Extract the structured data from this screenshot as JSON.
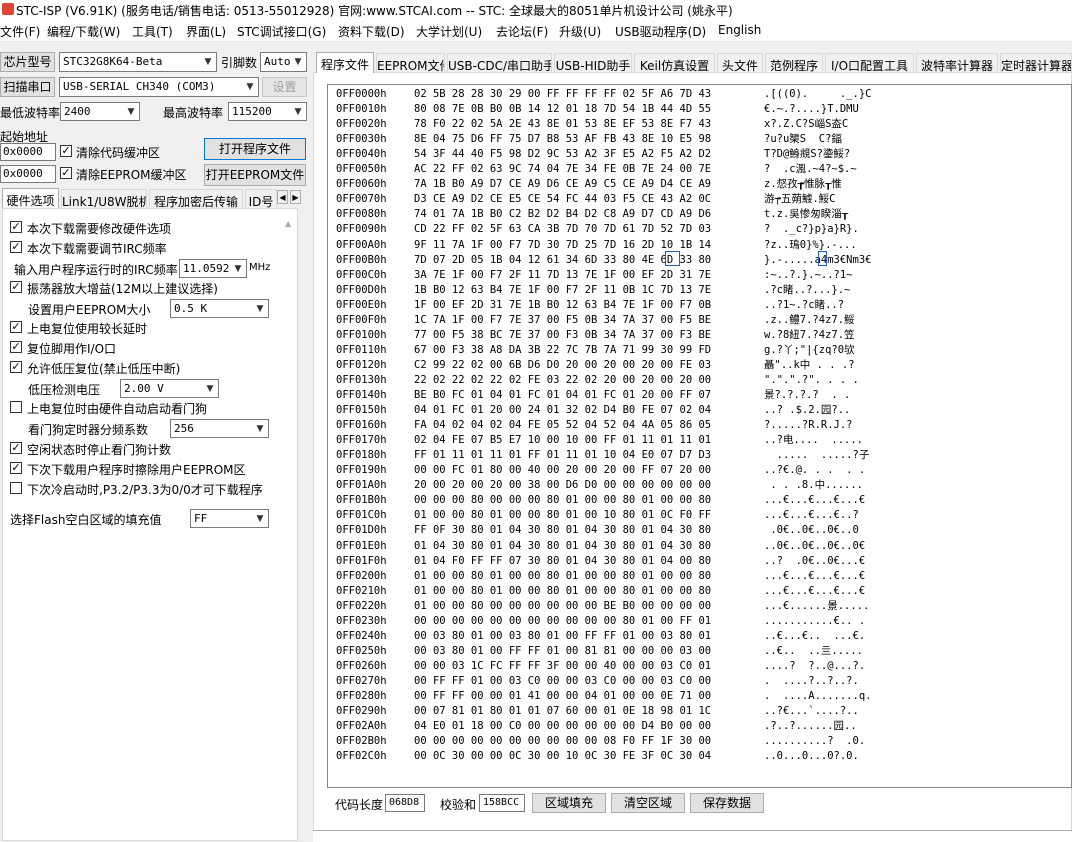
{
  "window": {
    "title": "STC-ISP (V6.91K) (服务电话/销售电话: 0513-55012928) 官网:www.STCAI.com  -- STC: 全球最大的8051单片机设计公司 (姚永平)"
  },
  "menu": [
    "文件(F)",
    "编程/下载(W)",
    "工具(T)",
    "界面(L)",
    "STC调试接口(G)",
    "资料下载(D)",
    "大学计划(U)",
    "去论坛(F)",
    "升级(U)",
    "USB驱动程序(D)",
    "English"
  ],
  "left": {
    "chip_label": "芯片型号",
    "chip_value": "STC32G8K64-Beta",
    "pins_label": "引脚数",
    "pins_value": "Auto",
    "scan_label": "扫描串口",
    "port_value": "USB-SERIAL CH340 (COM3)",
    "settings_label": "设置",
    "min_baud_label": "最低波特率",
    "min_baud_value": "2400",
    "max_baud_label": "最高波特率",
    "max_baud_value": "115200",
    "start_addr_label": "起始地址",
    "addr1": "0x0000",
    "clear_code_label": "清除代码缓冲区",
    "addr2": "0x0000",
    "clear_eeprom_label": "清除EEPROM缓冲区",
    "open_prog_label": "打开程序文件",
    "open_eeprom_label": "打开EEPROM文件",
    "tabs": [
      "硬件选项",
      "Link1/U8W脱机",
      "程序加密后传输",
      "ID号"
    ],
    "options": [
      {
        "label": "本次下载需要修改硬件选项",
        "checked": "✓"
      },
      {
        "label": "本次下载需要调节IRC频率",
        "checked": "✓"
      },
      {
        "label": "振荡器放大增益(12M以上建议选择)",
        "checked": "✓"
      },
      {
        "label": "上电复位使用较长延时",
        "checked": "✓"
      },
      {
        "label": "复位脚用作I/O口",
        "checked": "✓"
      },
      {
        "label": "允许低压复位(禁止低压中断)",
        "checked": "✓"
      },
      {
        "label": "上电复位时由硬件自动启动看门狗",
        "checked": ""
      },
      {
        "label": "空闲状态时停止看门狗计数",
        "checked": "✓"
      },
      {
        "label": "下次下载用户程序时擦除用户EEPROM区",
        "checked": "✓"
      },
      {
        "label": "下次冷启动时,P3.2/P3.3为0/0才可下载程序",
        "checked": ""
      }
    ],
    "irc_label": "输入用户程序运行时的IRC频率",
    "irc_value": "11.0592",
    "irc_unit": "MHz",
    "eeprom_size_label": "设置用户EEPROM大小",
    "eeprom_size_value": "0.5 K",
    "lvd_label": "低压检测电压",
    "lvd_value": "2.00 V",
    "wdt_label": "看门狗定时器分频系数",
    "wdt_value": "256",
    "fill_label": "选择Flash空白区域的填充值",
    "fill_value": "FF"
  },
  "right": {
    "tabs": [
      "程序文件",
      "EEPROM文件",
      "USB-CDC/串口助手",
      "USB-HID助手",
      "Keil仿真设置",
      "头文件",
      "范例程序",
      "I/O口配置工具",
      "波特率计算器",
      "定时器计算器"
    ],
    "rows": [
      {
        "addr": "0FF0000h",
        "hex": "02 5B 28 28 30 29 00 FF FF FF FF 02 5F A6 7D 43",
        "ascii": ".[((0).     ._.}C"
      },
      {
        "addr": "0FF0010h",
        "hex": "80 08 7E 0B B0 0B 14 12 01 18 7D 54 1B 44 4D 55",
        "ascii": "€.~.?....}T.DMU"
      },
      {
        "addr": "0FF0020h",
        "hex": "78 F0 22 02 5A 2E 43 8E 01 53 8E EF 53 8E F7 43",
        "ascii": "x?.Z.C?S崰S盇C"
      },
      {
        "addr": "0FF0030h",
        "hex": "8E 04 75 D6 FF 75 D7 B8 53 AF FB 43 8E 10 E5 98",
        "ascii": "?u?u榘S  C?鍢"
      },
      {
        "addr": "0FF0040h",
        "hex": "54 3F 44 40 F5 98 D2 9C 53 A2 3F E5 A2 F5 A2 D2",
        "ascii": "T?D@鯓覜S?鍌鮾?"
      },
      {
        "addr": "0FF0050h",
        "hex": "AC 22 FF 02 63 9C 74 04 7E 34 FE 0B 7E 24 00 7E",
        "ascii": "?  .c渢.~4?~$.~"
      },
      {
        "addr": "0FF0060h",
        "hex": "7A 1B B0 A9 D7 CE A9 D6 CE A9 C5 CE A9 D4 CE A9",
        "ascii": "z.惄孜┲惟脉┰惟"
      },
      {
        "addr": "0FF0070h",
        "hex": "D3 CE A9 D2 CE E5 CE 54 FC 44 03 F5 CE 43 A2 0C",
        "ascii": "游┮五蒴鰬.鮾C"
      },
      {
        "addr": "0FF0080h",
        "hex": "74 01 7A 1B B0 C2 B2 D2 B4 D2 C8 A9 D7 CD A9 D6",
        "ascii": "t.z.吳惨匆睽淄┰"
      },
      {
        "addr": "0FF0090h",
        "hex": "CD 22 FF 02 5F 63 CA 3B 7D 70 7D 61 7D 52 7D 03",
        "ascii": "?  ._c?}p}a}R}."
      },
      {
        "addr": "0FF00A0h",
        "hex": "9F 11 7A 1F 00 F7 7D 30 7D 25 7D 16 2D 10 1B 14",
        "ascii": "?z..鳿0}%}.-..."
      },
      {
        "addr": "0FF00B0h",
        "hex": "7D 07 2D 05 1B 04 12 61 34 6D 33 80 4E 6D 33 80",
        "ascii": "}.-.....a4m3€Nm3€"
      },
      {
        "addr": "0FF00C0h",
        "hex": "3A 7E 1F 00 F7 2F 11 7D 13 7E 1F 00 EF 2D 31 7E",
        "ascii": ":~..?.}.~..?1~"
      },
      {
        "addr": "0FF00D0h",
        "hex": "1B B0 12 63 B4 7E 1F 00 F7 2F 11 0B 1C 7D 13 7E",
        "ascii": ".?c睹..?...}.~"
      },
      {
        "addr": "0FF00E0h",
        "hex": "1F 00 EF 2D 31 7E 1B B0 12 63 B4 7E 1F 00 F7 0B",
        "ascii": "..?1~.?c睹..?"
      },
      {
        "addr": "0FF00F0h",
        "hex": "1C 7A 1F 00 F7 7E 37 00 F5 0B 34 7A 37 00 F5 BE",
        "ascii": ".z..鳢7.?4z7.鮾"
      },
      {
        "addr": "0FF0100h",
        "hex": "77 00 F5 38 BC 7E 37 00 F3 0B 34 7A 37 00 F3 BE",
        "ascii": "w.?8紐7.?4z7.笠"
      },
      {
        "addr": "0FF0110h",
        "hex": "67 00 F3 38 A8 DA 3B 22 7C 7B 7A 71 99 30 99 FD",
        "ascii": "g.?丫;\"|{zq?0欤"
      },
      {
        "addr": "0FF0120h",
        "hex": "C2 99 22 02 00 6B D6 D0 20 00 20 00 20 00 FE 03",
        "ascii": "聶\"..k中 . . .?"
      },
      {
        "addr": "0FF0130h",
        "hex": "22 02 22 02 22 02 FE 03 22 02 20 00 20 00 20 00",
        "ascii": "\".\".\".?\". . . ."
      },
      {
        "addr": "0FF0140h",
        "hex": "BE B0 FC 01 04 01 FC 01 04 01 FC 01 20 00 FF 07",
        "ascii": "景?.?.?.?  . ."
      },
      {
        "addr": "0FF0150h",
        "hex": "04 01 FC 01 20 00 24 01 32 02 D4 B0 FE 07 02 04",
        "ascii": "..? .$.2.园?.."
      },
      {
        "addr": "0FF0160h",
        "hex": "FA 04 02 04 02 04 FE 05 52 04 52 04 4A 05 86 05",
        "ascii": "?.....?R.R.J.?"
      },
      {
        "addr": "0FF0170h",
        "hex": "02 04 FE 07 B5 E7 10 00 10 00 FF 01 11 01 11 01",
        "ascii": "..?电....  ....."
      },
      {
        "addr": "0FF0180h",
        "hex": "FF 01 11 01 11 01 FF 01 11 01 10 04 E0 07 D7 D3",
        "ascii": "  .....  .....?子"
      },
      {
        "addr": "0FF0190h",
        "hex": "00 00 FC 01 80 00 40 00 20 00 20 00 FF 07 20 00",
        "ascii": "..?€.@. . .  . ."
      },
      {
        "addr": "0FF01A0h",
        "hex": "20 00 20 00 20 00 38 00 D6 D0 00 00 00 00 00 00",
        "ascii": " . . .8.中......"
      },
      {
        "addr": "0FF01B0h",
        "hex": "00 00 00 80 00 00 00 80 01 00 00 80 01 00 00 80",
        "ascii": "...€...€...€...€"
      },
      {
        "addr": "0FF01C0h",
        "hex": "01 00 00 80 01 00 00 80 01 00 10 80 01 0C F0 FF",
        "ascii": "...€...€...€..?"
      },
      {
        "addr": "0FF01D0h",
        "hex": "FF 0F 30 80 01 04 30 80 01 04 30 80 01 04 30 80",
        "ascii": " .0€..0€..0€..0"
      },
      {
        "addr": "0FF01E0h",
        "hex": "01 04 30 80 01 04 30 80 01 04 30 80 01 04 30 80",
        "ascii": "..0€..0€..0€..0€"
      },
      {
        "addr": "0FF01F0h",
        "hex": "01 04 F0 FF FF 07 30 80 01 04 30 80 01 04 00 80",
        "ascii": "..?  .0€..0€...€"
      },
      {
        "addr": "0FF0200h",
        "hex": "01 00 00 80 01 00 00 80 01 00 00 80 01 00 00 80",
        "ascii": "...€...€...€...€"
      },
      {
        "addr": "0FF0210h",
        "hex": "01 00 00 80 01 00 00 80 01 00 00 80 01 00 00 80",
        "ascii": "...€...€...€...€"
      },
      {
        "addr": "0FF0220h",
        "hex": "01 00 00 80 00 00 00 00 00 00 BE B0 00 00 00 00",
        "ascii": "...€......景....."
      },
      {
        "addr": "0FF0230h",
        "hex": "00 00 00 00 00 00 00 00 00 00 00 80 01 00 FF 01",
        "ascii": "...........€.. ."
      },
      {
        "addr": "0FF0240h",
        "hex": "00 03 80 01 00 03 80 01 00 FF FF 01 00 03 80 01",
        "ascii": "..€...€..  ...€."
      },
      {
        "addr": "0FF0250h",
        "hex": "00 03 80 01 00 FF FF 01 00 81 81 00 00 00 03 00",
        "ascii": "..€..  ..亖....."
      },
      {
        "addr": "0FF0260h",
        "hex": "00 00 03 1C FC FF FF 3F 00 00 40 00 00 03 C0 01",
        "ascii": "....?  ?..@...?."
      },
      {
        "addr": "0FF0270h",
        "hex": "00 FF FF 01 00 03 C0 00 00 03 C0 00 00 03 C0 00",
        "ascii": ".  ....?..?..?."
      },
      {
        "addr": "0FF0280h",
        "hex": "00 FF FF 00 00 01 41 00 00 04 01 00 00 0E 71 00",
        "ascii": ".  ....A.......q."
      },
      {
        "addr": "0FF0290h",
        "hex": "00 07 81 01 80 01 01 07 60 00 01 0E 18 98 01 1C",
        "ascii": "..?€...`....?.."
      },
      {
        "addr": "0FF02A0h",
        "hex": "04 E0 01 18 00 C0 00 00 00 00 00 00 D4 B0 00 00",
        "ascii": ".?..?......园.."
      },
      {
        "addr": "0FF02B0h",
        "hex": "00 00 00 00 00 00 00 00 00 00 08 F0 FF 1F 30 00",
        "ascii": "..........?  .0."
      },
      {
        "addr": "0FF02C0h",
        "hex": "00 0C 30 00 00 0C 30 00 10 0C 30 FE 3F 0C 30 04",
        "ascii": "..0...0...0?.0."
      }
    ],
    "code_len_label": "代码长度",
    "code_len_value": "068D8",
    "checksum_label": "校验和",
    "checksum_value": "158BCC",
    "fill_area_label": "区域填充",
    "clear_area_label": "清空区域",
    "save_label": "保存数据"
  }
}
